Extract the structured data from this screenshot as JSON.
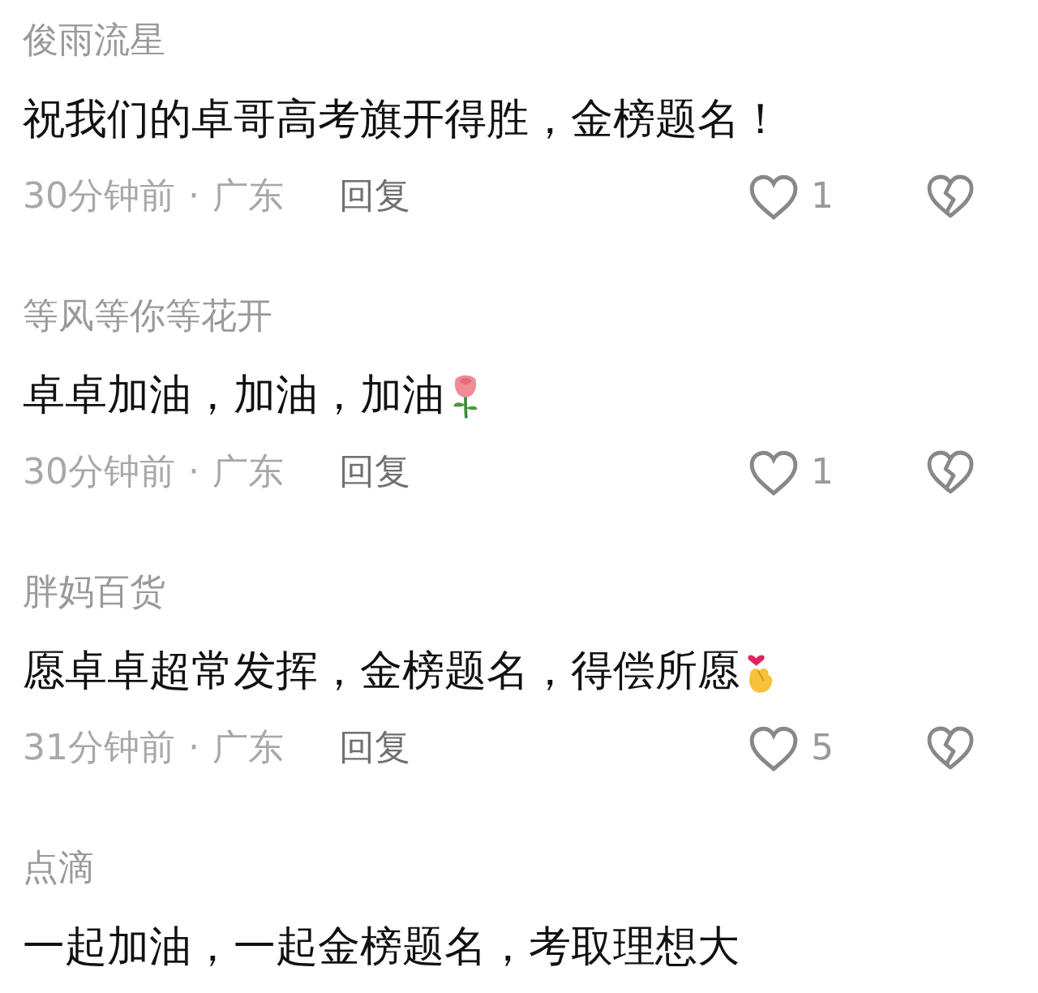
{
  "comments": [
    {
      "author": "俊雨流星",
      "text": "祝我们的卓哥高考旗开得胜，金榜题名！",
      "kind": "plain",
      "time": "30分钟前",
      "separator": "·",
      "location": "广东",
      "reply": "回复",
      "likes": "1"
    },
    {
      "author": "等风等你等花开",
      "text": "卓卓加油，加油，加油",
      "kind": "rose",
      "time": "30分钟前",
      "separator": "·",
      "location": "广东",
      "reply": "回复",
      "likes": "1"
    },
    {
      "author": "胖妈百货",
      "text": "愿卓卓超常发挥，金榜题名，得偿所愿",
      "kind": "finger_heart",
      "time": "31分钟前",
      "separator": "·",
      "location": "广东",
      "reply": "回复",
      "likes": "5"
    },
    {
      "author": "点滴",
      "text": "一起加油，一起金榜题名，考取理想大",
      "kind": "plain"
    }
  ]
}
